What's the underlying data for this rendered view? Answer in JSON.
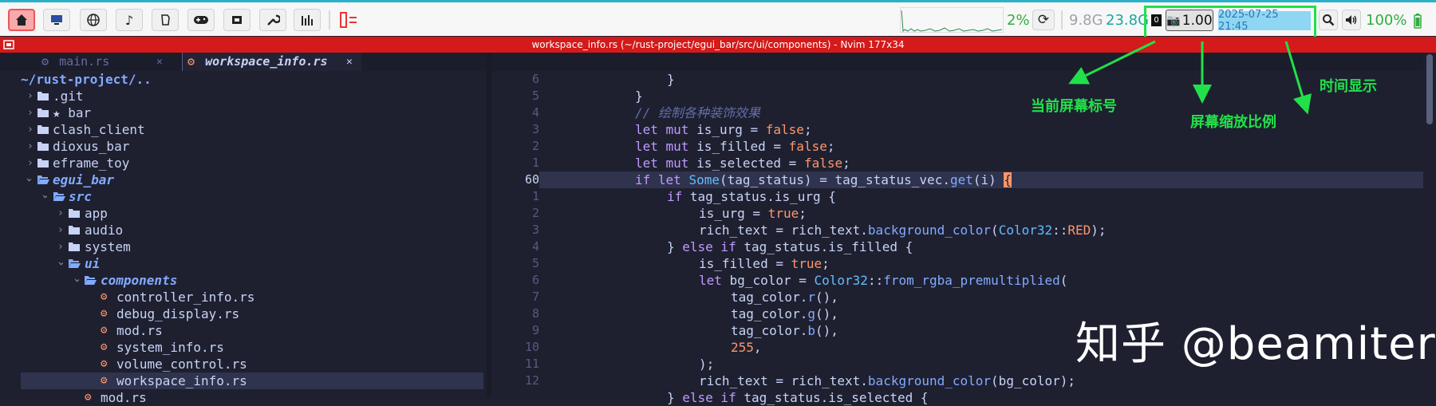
{
  "topbar": {
    "cpu_percent": "2%",
    "mem_used": "9.8G",
    "mem_avail": "23.8G",
    "screen_index": "0",
    "scale": "1.00",
    "datetime": "2025-07-25 21:45",
    "volume": "100%",
    "colors": {
      "accent": "#2bb0c9",
      "active_bg": "#f7a9ab",
      "green_box": "#22e04a",
      "date_bg": "#8fd6f2"
    }
  },
  "titlebar": {
    "title": "workspace_info.rs (~/rust-project/egui_bar/src/ui/components) - Nvim 177x34"
  },
  "tabs": [
    {
      "label": "main.rs",
      "close": "✕"
    },
    {
      "label": "workspace_info.rs",
      "close": "✕"
    }
  ],
  "tree": {
    "root": "~/rust-project/..",
    "items": [
      {
        "label": ".git"
      },
      {
        "label": "★ bar"
      },
      {
        "label": "clash_client"
      },
      {
        "label": "dioxus_bar"
      },
      {
        "label": "eframe_toy"
      },
      {
        "label": "egui_bar"
      },
      {
        "label": "src"
      },
      {
        "label": "app"
      },
      {
        "label": "audio"
      },
      {
        "label": "system"
      },
      {
        "label": "ui"
      },
      {
        "label": "components"
      },
      {
        "label": "controller_info.rs"
      },
      {
        "label": "debug_display.rs"
      },
      {
        "label": "mod.rs"
      },
      {
        "label": "system_info.rs"
      },
      {
        "label": "volume_control.rs"
      },
      {
        "label": "workspace_info.rs"
      },
      {
        "label": "mod.rs"
      }
    ]
  },
  "gutter": [
    "6",
    "5",
    "4",
    "3",
    "2",
    "1",
    "60",
    "1",
    "2",
    "3",
    "4",
    "5",
    "6",
    "7",
    "8",
    "9",
    "10",
    "11",
    "12"
  ],
  "code": {
    "l0": "}",
    "l1": "}",
    "l2": "// 绘制各种装饰效果",
    "l3_kw": "let mut",
    "l3_id": " is_urg = ",
    "l3_bo": "false",
    "l3_end": ";",
    "l4_kw": "let mut",
    "l4_id": " is_filled = ",
    "l4_bo": "false",
    "l4_end": ";",
    "l5_kw": "let mut",
    "l5_id": " is_selected = ",
    "l5_bo": "false",
    "l5_end": ";",
    "l6_kw": "if let",
    "l6_ty": "Some",
    "l6_a": "(tag_status) = tag_status_vec.",
    "l6_fn": "get",
    "l6_b": "(i) ",
    "l6_br": "{",
    "l7_kw": "if",
    "l7_a": " tag_status.is_urg {",
    "l8_a": "is_urg = ",
    "l8_bo": "true",
    "l8_end": ";",
    "l9_a": "rich_text = rich_text.",
    "l9_fn": "background_color",
    "l9_b": "(",
    "l9_ty": "Color32",
    "l9_c": "::",
    "l9_cn": "RED",
    "l9_d": ");",
    "l10_a": "} ",
    "l10_kw": "else if",
    "l10_b": " tag_status.is_filled {",
    "l11_a": "is_filled = ",
    "l11_bo": "true",
    "l11_end": ";",
    "l12_kw": "let",
    "l12_a": " bg_color = ",
    "l12_ty": "Color32",
    "l12_b": "::",
    "l12_fn": "from_rgba_premultiplied",
    "l12_c": "(",
    "l13_a": "tag_color.",
    "l13_fn": "r",
    "l13_b": "(),",
    "l14_a": "tag_color.",
    "l14_fn": "g",
    "l14_b": "(),",
    "l15_a": "tag_color.",
    "l15_fn": "b",
    "l15_b": "(),",
    "l16_cn": "255",
    "l16_b": ",",
    "l17_a": ");",
    "l18_a": "rich_text = rich_text.",
    "l18_fn": "background_color",
    "l18_b": "(bg_color);",
    "l19_a": "} ",
    "l19_kw": "else if",
    "l19_b": " tag_status.is_selected {"
  },
  "annotations": {
    "screen_index_label": "当前屏幕标号",
    "scale_label": "屏幕缩放比例",
    "time_label": "时间显示"
  },
  "watermark": "知乎 @beamiter"
}
